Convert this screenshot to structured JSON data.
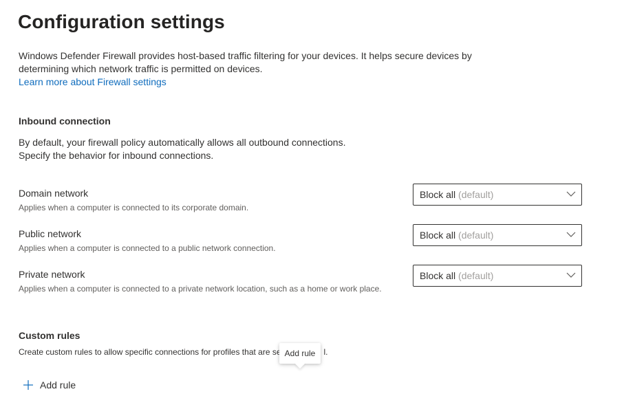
{
  "page": {
    "title": "Configuration settings",
    "intro_line1": "Windows Defender Firewall provides host-based traffic filtering for your devices. It helps secure devices by",
    "intro_line2": "determining which network traffic is permitted on devices.",
    "learn_more_link": "Learn more about Firewall settings"
  },
  "inbound": {
    "title": "Inbound connection",
    "desc_line1": "By default, your firewall policy automatically allows all outbound connections.",
    "desc_line2": "Specify the behavior for inbound connections.",
    "networks": [
      {
        "label": "Domain network",
        "help": "Applies when a computer is connected to its corporate domain.",
        "selected": "Block all",
        "selected_suffix": "(default)"
      },
      {
        "label": "Public network",
        "help": "Applies when a computer is connected to a public network connection.",
        "selected": "Block all",
        "selected_suffix": "(default)"
      },
      {
        "label": "Private network",
        "help": "Applies when a computer is connected to a private network location, such as a home or work place.",
        "selected": "Block all",
        "selected_suffix": "(default)"
      }
    ]
  },
  "custom_rules": {
    "title": "Custom rules",
    "desc": "Create custom rules to allow specific connections for profiles that are se",
    "desc_tail": "l.",
    "tooltip": "Add rule",
    "add_button_label": "Add rule",
    "add_button_icon": "plus-icon"
  },
  "colors": {
    "link": "#0f6cbd",
    "text": "#323130",
    "muted": "#a19f9d"
  },
  "icons": {
    "dropdown": "chevron-down-icon"
  }
}
